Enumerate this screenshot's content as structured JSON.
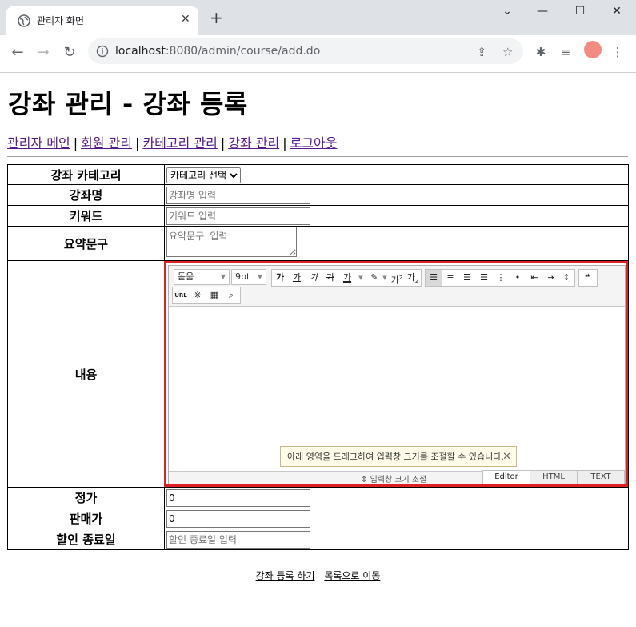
{
  "browser": {
    "tab_title": "관리자 화면",
    "url_host": "localhost",
    "url_path": ":8080/admin/course/add.do"
  },
  "page": {
    "title": "강좌 관리 - 강좌 등록",
    "nav": [
      {
        "label": "관리자 메인"
      },
      {
        "label": "회원 관리"
      },
      {
        "label": "카테고리 관리"
      },
      {
        "label": "강좌 관리"
      },
      {
        "label": "로그아웃"
      }
    ],
    "nav_separator": "|"
  },
  "form": {
    "category_label": "강좌 카테고리",
    "category_selected": "카테고리 선택",
    "name_label": "강좌명",
    "name_placeholder": "강좌명 입력",
    "keyword_label": "키워드",
    "keyword_placeholder": "키워드 입력",
    "summary_label": "요약문구",
    "summary_placeholder": "요약문구 입력",
    "content_label": "내용",
    "price_label": "정가",
    "price_value": "0",
    "sale_price_label": "판매가",
    "sale_price_value": "0",
    "sale_end_label": "할인 종료일",
    "sale_end_placeholder": "할인 종료일 입력"
  },
  "editor": {
    "font_family": "돋움",
    "font_size": "9pt",
    "buttons": {
      "bold": "가",
      "underline": "가",
      "italic": "가",
      "strike": "가",
      "color": "가",
      "superscript": "가",
      "subscript": "가",
      "url": "URL"
    },
    "tooltip": "아래 영역을 드래그하여 입력창 크기를 조절할 수 있습니다.",
    "resize_label": "입력창 크기 조절",
    "modes": [
      "Editor",
      "HTML",
      "TEXT"
    ],
    "highlight_color": "#e02020"
  },
  "actions": {
    "submit": "강좌 등록 하기",
    "list": "목록으로 이동"
  }
}
